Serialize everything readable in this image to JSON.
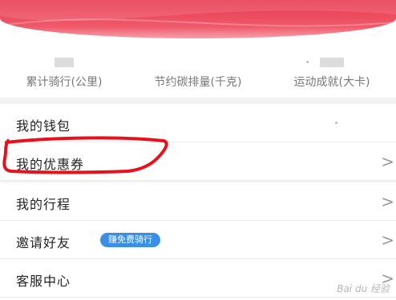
{
  "stats": [
    {
      "label": "累计骑行(公里)"
    },
    {
      "label": "节约碳排量(千克)"
    },
    {
      "label": "运动成就(大卡)"
    }
  ],
  "menu": [
    {
      "label": "我的钱包"
    },
    {
      "label": "我的优惠券",
      "chevron": ">"
    },
    {
      "label": "我的行程",
      "chevron": ">"
    },
    {
      "label": "邀请好友",
      "badge": "赚免费骑行",
      "chevron": ">"
    },
    {
      "label": "客服中心",
      "chevron": ">"
    }
  ],
  "colors": {
    "header": "#e8384f",
    "badge": "#3a8ee6",
    "annotation": "#e8101c"
  },
  "watermark": "Bai du 经验"
}
